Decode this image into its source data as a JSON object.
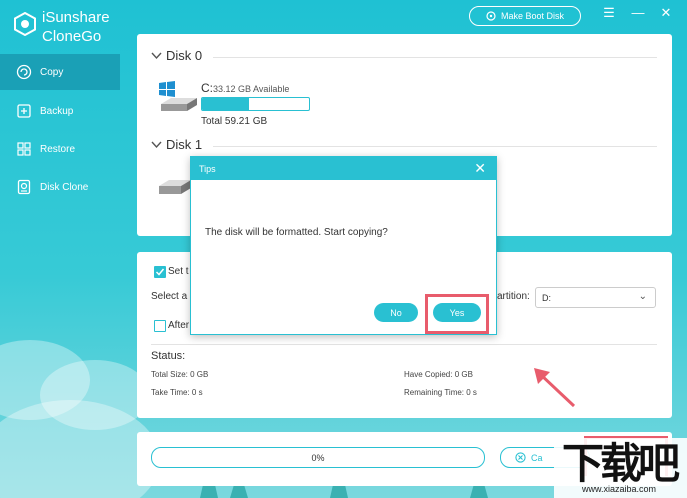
{
  "app": {
    "name_line1": "iSunshare",
    "name_line2": "CloneGo"
  },
  "topbar": {
    "boot_label": "Make Boot Disk",
    "menu_glyph": "☰",
    "min_glyph": "—",
    "close_glyph": "✕"
  },
  "sidebar": {
    "items": [
      {
        "label": "Copy",
        "icon": "copy-icon",
        "active": true
      },
      {
        "label": "Backup",
        "icon": "backup-icon",
        "active": false
      },
      {
        "label": "Restore",
        "icon": "restore-icon",
        "active": false
      },
      {
        "label": "Disk Clone",
        "icon": "disk-clone-icon",
        "active": false
      }
    ]
  },
  "disks": [
    {
      "title": "Disk 0",
      "drive": {
        "letter": "C:",
        "available": "33.12 GB Available",
        "total": "Total 59.21 GB",
        "used_fraction": 0.44
      }
    },
    {
      "title": "Disk 1"
    }
  ],
  "options": {
    "set_label": "Set t",
    "select_label": "Select a",
    "partition_label": "artition:",
    "partition_value": "D:",
    "after_label": "After"
  },
  "status": {
    "title": "Status:",
    "total_size": "Total Size: 0 GB",
    "have_copied": "Have Copied: 0 GB",
    "take_time": "Take Time: 0 s",
    "remaining_time": "Remaining Time: 0 s"
  },
  "progress": {
    "percent_label": "0%",
    "cancel_label": "Ca"
  },
  "dialog": {
    "title": "Tips",
    "message": "The disk will be formatted. Start copying?",
    "no_label": "No",
    "yes_label": "Yes"
  },
  "watermark": {
    "logo": "下载吧",
    "url": "www.xiazaiba.com"
  },
  "colors": {
    "accent": "#29c0d2",
    "highlight": "#e85c6c",
    "sidebar_active": "#1aa0b6"
  }
}
